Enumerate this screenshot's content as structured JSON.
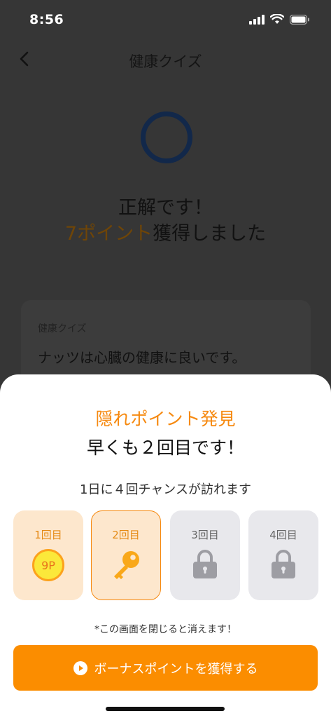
{
  "status_bar": {
    "time": "8:56"
  },
  "nav": {
    "title": "健康クイズ"
  },
  "result": {
    "line1": "正解です！",
    "points": "7ポイント",
    "line2_rest": "獲得しました"
  },
  "quiz_card": {
    "label": "健康クイズ",
    "question": "ナッツは心臓の健康に良いです。"
  },
  "sheet": {
    "title": "隠れポイント発見",
    "subtitle": "早くも２回目です！",
    "info": "1日に４回チャンスが訪れます",
    "cards": [
      {
        "label": "1回目",
        "state": "opened",
        "reward": "9P",
        "icon": "coin-icon"
      },
      {
        "label": "2回目",
        "state": "current",
        "icon": "key-icon"
      },
      {
        "label": "3回目",
        "state": "locked",
        "icon": "lock-icon"
      },
      {
        "label": "4回目",
        "state": "locked",
        "icon": "lock-icon"
      }
    ],
    "note": "*この画面を閉じると消えます！",
    "button_label": "ボーナスポイントを獲得する"
  },
  "colors": {
    "accent": "#fb8d00",
    "overlay": "#363636",
    "card_active_bg": "#fde7cd",
    "card_locked_bg": "#e8e8ec"
  }
}
